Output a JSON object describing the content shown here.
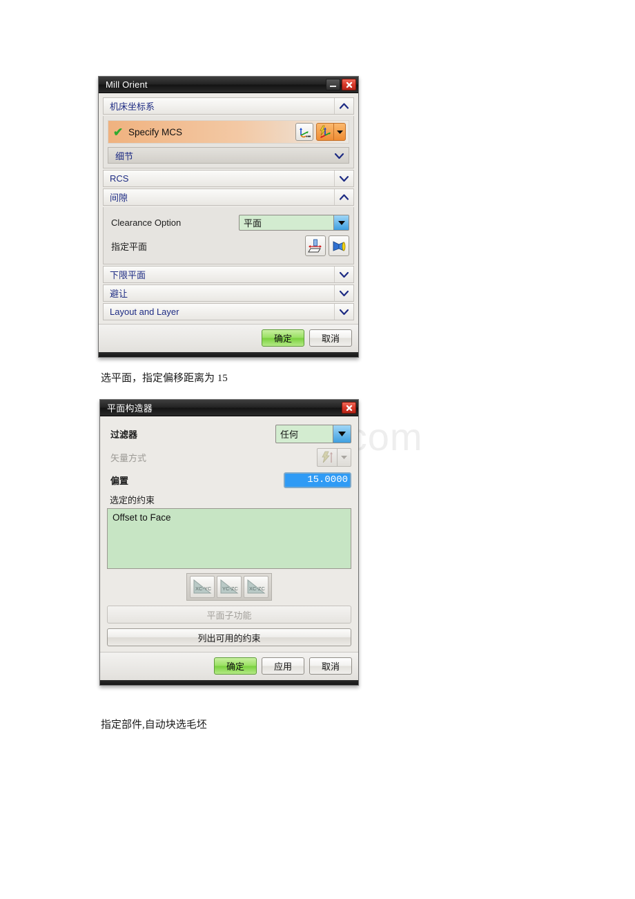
{
  "page": {
    "watermark": "www.bdocx.com"
  },
  "dialog1": {
    "title": "Mill Orient",
    "minimize_icon": "minimize-icon",
    "close_icon": "close-icon",
    "groups": {
      "mcs": {
        "label": "机床坐标系",
        "state_icon": "chevron-up-icon",
        "specify_mcs": {
          "check_icon": "check-icon",
          "label": "Specify MCS",
          "select_icon": "csys-select-icon",
          "csys_icon": "csys-dynamic-icon",
          "dropdown_icon": "chevron-down-icon"
        },
        "details": {
          "label": "细节",
          "state_icon": "chevron-down-icon"
        }
      },
      "rcs": {
        "label": "RCS",
        "state_icon": "chevron-down-icon"
      },
      "clearance": {
        "label": "间隙",
        "state_icon": "chevron-up-icon",
        "option_label": "Clearance Option",
        "option_value": "平面",
        "option_dropdown_icon": "chevron-down-icon",
        "specify_plane_label": "指定平面",
        "plane_icon": "plane-constructor-icon",
        "inherit_icon": "flashlight-icon"
      },
      "lower_limit_plane": {
        "label": "下限平面",
        "state_icon": "chevron-down-icon"
      },
      "avoidance": {
        "label": "避让",
        "state_icon": "chevron-down-icon"
      },
      "layout_and_layer": {
        "label": "Layout and Layer",
        "state_icon": "chevron-down-icon"
      }
    },
    "footer": {
      "ok": "确定",
      "cancel": "取消"
    }
  },
  "caption1": "选平面，指定偏移距离为 15",
  "dialog2": {
    "title": "平面构造器",
    "close_icon": "close-icon",
    "filter": {
      "label": "过滤器",
      "value": "任何",
      "dropdown_icon": "chevron-down-icon"
    },
    "vector_method": {
      "label": "矢量方式",
      "icon": "vector-inferred-icon",
      "dropdown_icon": "chevron-down-icon"
    },
    "offset": {
      "label": "偏置",
      "value": "15.0000"
    },
    "selected_constraints": {
      "label": "选定的约束",
      "items": [
        "Offset to Face"
      ]
    },
    "plane_toggles": [
      {
        "label": "XC-YC",
        "name": "xc-yc-plane-button"
      },
      {
        "label": "YC-ZC",
        "name": "yc-zc-plane-button"
      },
      {
        "label": "XC-ZC",
        "name": "xc-zc-plane-button"
      }
    ],
    "plane_subfunction": "平面子功能",
    "list_constraints": "列出可用的约束",
    "footer": {
      "ok": "确定",
      "apply": "应用",
      "cancel": "取消"
    }
  },
  "caption2": "指定部件,自动块选毛坯"
}
